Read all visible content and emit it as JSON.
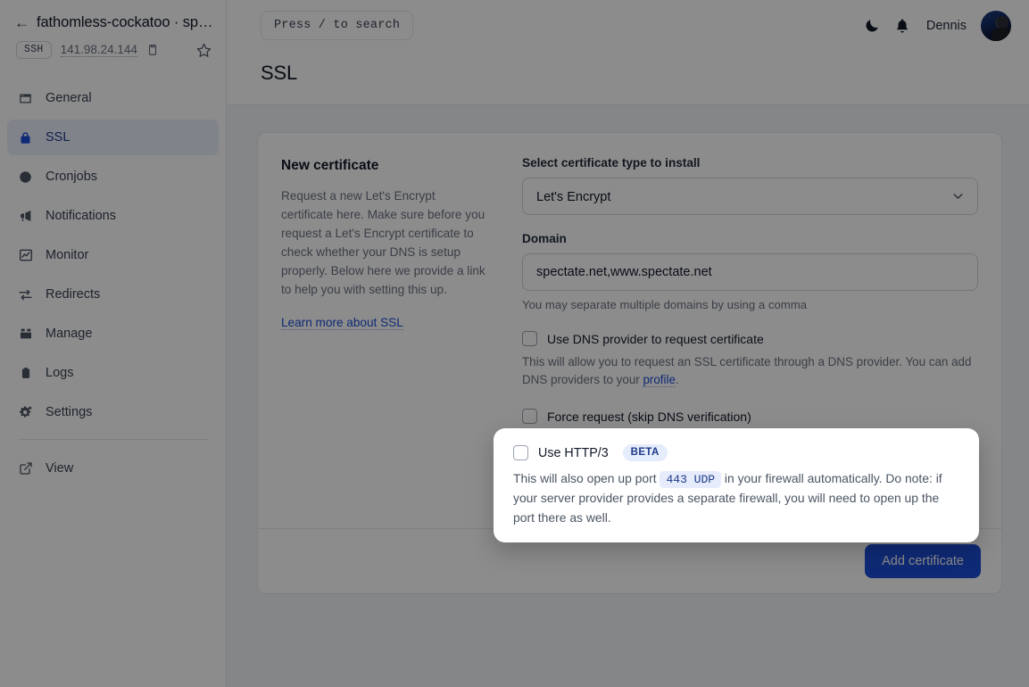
{
  "sidebar": {
    "back_arrow": "←",
    "server_name": "fathomless-cockatoo · sp…",
    "connection_badge": "SSH",
    "ip_address": "141.98.24.144",
    "items": [
      {
        "label": "General",
        "icon": "browser-icon",
        "active": false
      },
      {
        "label": "SSL",
        "icon": "lock-icon",
        "active": true
      },
      {
        "label": "Cronjobs",
        "icon": "clock-icon",
        "active": false
      },
      {
        "label": "Notifications",
        "icon": "megaphone-icon",
        "active": false
      },
      {
        "label": "Monitor",
        "icon": "chart-line-icon",
        "active": false
      },
      {
        "label": "Redirects",
        "icon": "arrows-swap-icon",
        "active": false
      },
      {
        "label": "Manage",
        "icon": "toolbox-icon",
        "active": false
      },
      {
        "label": "Logs",
        "icon": "clipboard-list-icon",
        "active": false
      },
      {
        "label": "Settings",
        "icon": "gears-icon",
        "active": false
      }
    ],
    "footer_items": [
      {
        "label": "View",
        "icon": "external-link-icon"
      }
    ]
  },
  "topbar": {
    "search_label": "Press / to search",
    "user_name": "Dennis"
  },
  "page": {
    "title": "SSL"
  },
  "card": {
    "desc_title": "New certificate",
    "desc_text": "Request a new Let's Encrypt certificate here. Make sure before you request a Let's Encrypt certificate to check whether your DNS is setup properly. Below here we provide a link to help you with setting this up.",
    "desc_link": "Learn more about SSL",
    "cert_type_label": "Select certificate type to install",
    "cert_type_value": "Let's Encrypt",
    "cert_type_options": [
      "Let's Encrypt"
    ],
    "domain_label": "Domain",
    "domain_value": "spectate.net,www.spectate.net",
    "domain_help": "You may separate multiple domains by using a comma",
    "dns_checkbox_label": "Use DNS provider to request certificate",
    "dns_help_before": "This will allow you to request an SSL certificate through a DNS provider. You can add DNS providers to your ",
    "dns_help_link": "profile",
    "dns_help_after": ".",
    "force_checkbox_label": "Force request (skip DNS verification)",
    "submit_label": "Add certificate"
  },
  "spotlight": {
    "checkbox_label": "Use HTTP/3",
    "badge": "BETA",
    "text_before": "This will also open up port ",
    "code": "443 UDP",
    "text_after": " in your firewall automatically. Do note: if your server provider provides a separate firewall, you will need to open up the port there as well."
  },
  "colors": {
    "accent": "#1d4ed8",
    "active_nav_bg": "#eceefb",
    "badge_bg": "#e5ecfb",
    "page_bg": "#f3f4f6",
    "overlay": "rgba(0,0,0,0.45)"
  }
}
